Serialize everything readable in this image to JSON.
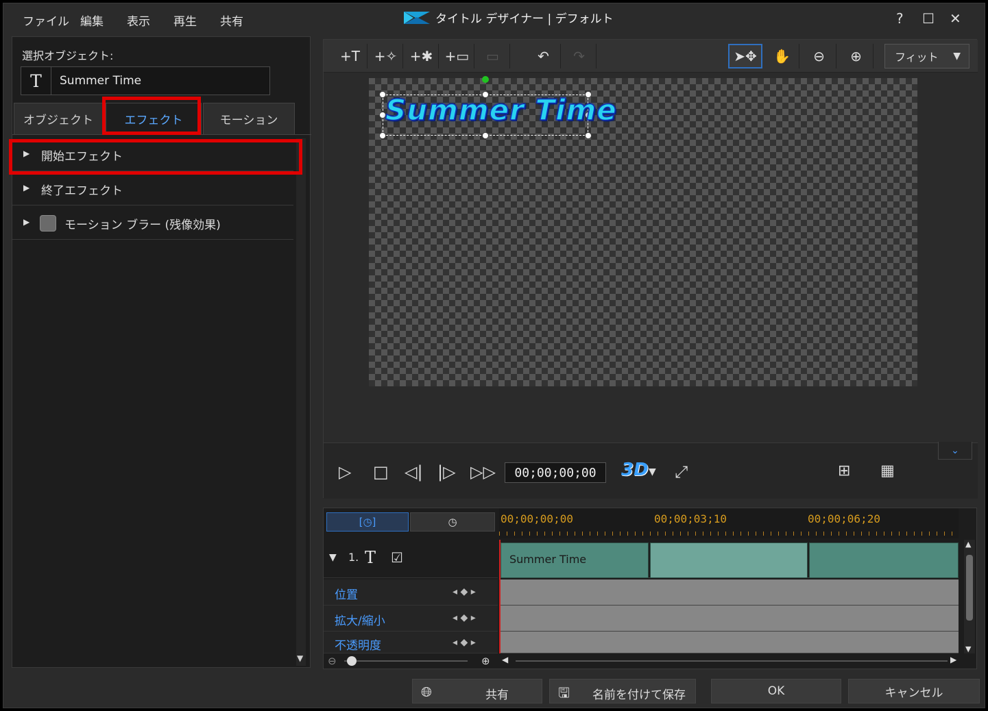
{
  "menu": [
    "ファイル",
    "編集",
    "表示",
    "再生",
    "共有"
  ],
  "window": {
    "title": "タイトル デザイナー | デフォルト",
    "help": "?",
    "maximize": "☐",
    "close": "✕"
  },
  "left": {
    "selected_label": "選択オブジェクト:",
    "object_name": "Summer Time",
    "object_icon": "T",
    "tabs": [
      "オブジェクト",
      "エフェクト",
      "モーション"
    ],
    "selected_tab": "エフェクト",
    "rows": [
      "開始エフェクト",
      "終了エフェクト",
      "モーション ブラー (残像効果)"
    ]
  },
  "toolbar": {
    "fit_label": "フィット"
  },
  "canvas": {
    "text": "Summer Time"
  },
  "playback": {
    "timecode": "00;00;00;00",
    "three_d": "3D"
  },
  "timeline": {
    "ruler": [
      "00;00;00;00",
      "00;00;03;10",
      "00;00;06;20"
    ],
    "track_number": "1.",
    "track_icon": "T",
    "clip_label": "Summer Time",
    "props": [
      "位置",
      "拡大/縮小",
      "不透明度"
    ]
  },
  "buttons": {
    "share": "共有",
    "save_as": "名前を付けて保存",
    "ok": "OK",
    "cancel": "キャンセル"
  },
  "colors": {
    "accent": "#4a9cff",
    "highlight": "#e00000",
    "clip": "#6fa69a",
    "title_text": "#29d2f0"
  }
}
